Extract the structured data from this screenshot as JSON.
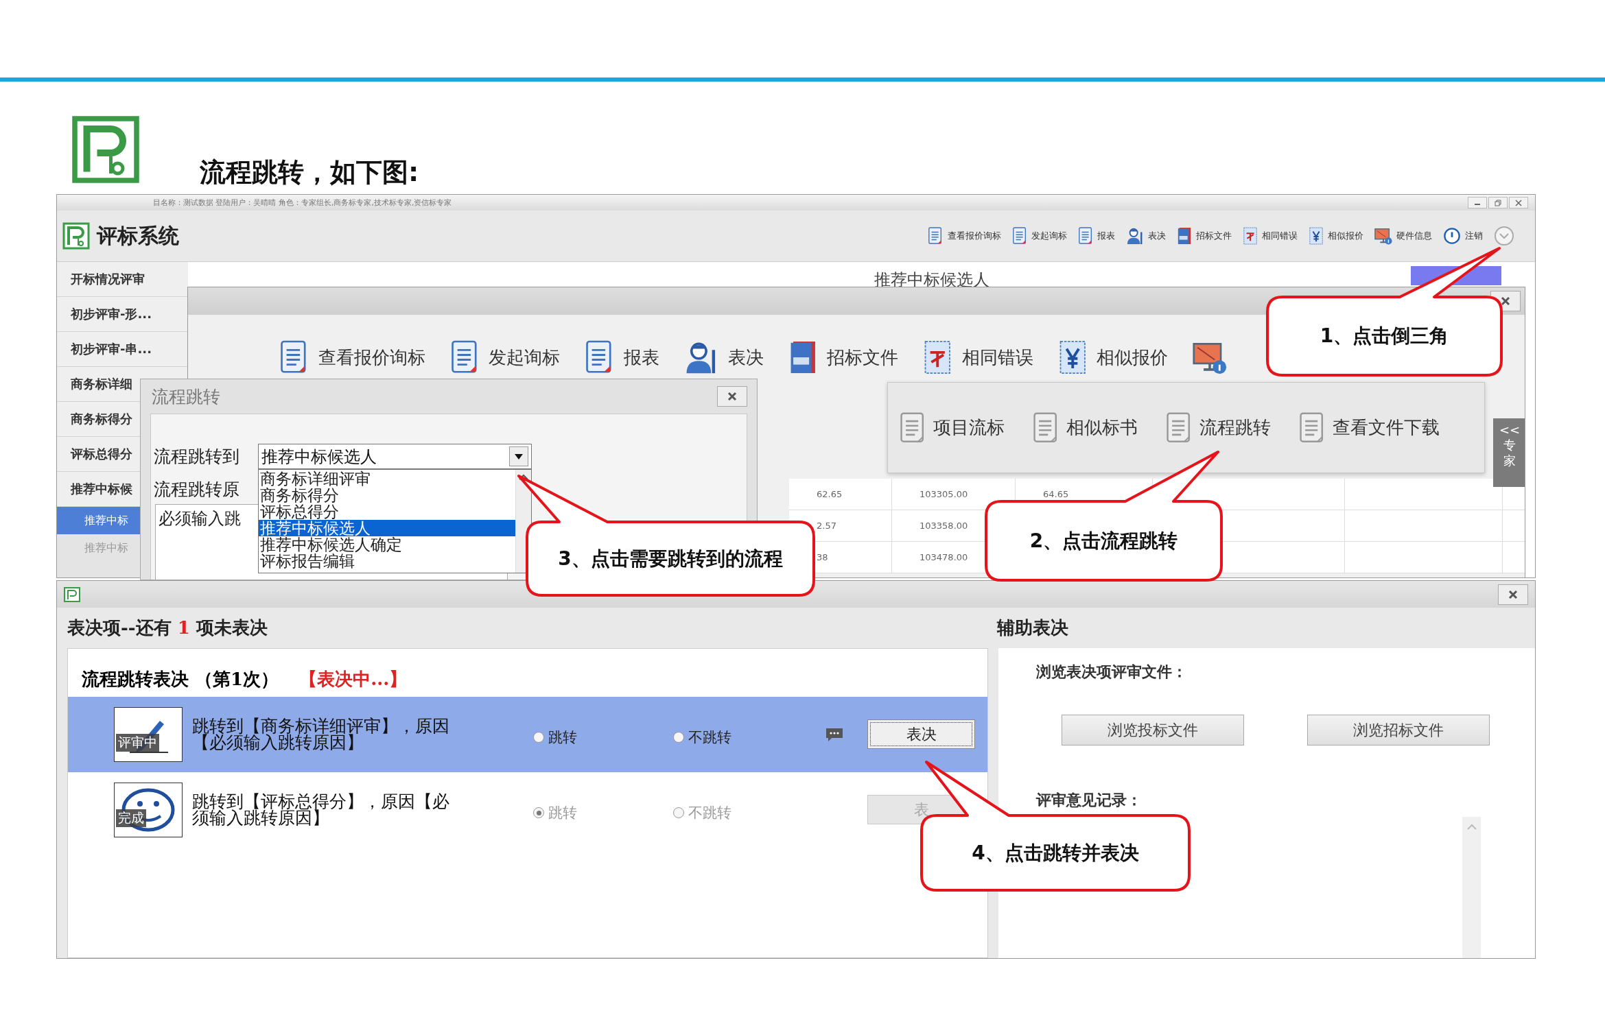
{
  "slide": {
    "title": "流程跳转，如下图:"
  },
  "main_window": {
    "info_bar": "目名称：测试数据 登陆用户：吴晴晴 角色：专家组长,商务标专家,技术标专家,资信标专家",
    "app_title": "评标系统",
    "toolbar": [
      {
        "label": "查看报价询标"
      },
      {
        "label": "发起询标"
      },
      {
        "label": "报表"
      },
      {
        "label": "表决"
      },
      {
        "label": "招标文件"
      },
      {
        "label": "相同错误"
      },
      {
        "label": "相似报价"
      },
      {
        "label": "硬件信息"
      },
      {
        "label": "注销"
      }
    ],
    "sidebar": {
      "items": [
        {
          "label": "开标情况评审",
          "selected": false
        },
        {
          "label": "初步评审-形...",
          "selected": false
        },
        {
          "label": "初步评审-串...",
          "selected": false
        },
        {
          "label": "商务标详细",
          "selected": false
        },
        {
          "label": "商务标得分",
          "selected": false
        },
        {
          "label": "评标总得分",
          "selected": false
        },
        {
          "label": "推荐中标候",
          "selected": false,
          "children": [
            {
              "label": "推荐中标",
              "selected": true
            },
            {
              "label": "推荐中标",
              "selected": false
            }
          ]
        }
      ]
    },
    "content_title": "推荐中标候选人"
  },
  "tool_window": {
    "toolbar": [
      {
        "label": "查看报价询标"
      },
      {
        "label": "发起询标"
      },
      {
        "label": "报表"
      },
      {
        "label": "表决"
      },
      {
        "label": "招标文件"
      },
      {
        "label": "相同错误"
      },
      {
        "label": "相似报价"
      }
    ],
    "menu": {
      "items": [
        {
          "label": "项目流标"
        },
        {
          "label": "相似标书"
        },
        {
          "label": "流程跳转"
        },
        {
          "label": "查看文件下载"
        }
      ]
    },
    "table": {
      "rows": [
        [
          "62.65",
          "103305.00",
          "64.65"
        ],
        [
          "2.57",
          "103358.00"
        ],
        [
          "38",
          "103478.00"
        ]
      ]
    },
    "side_tab": {
      "arrows": "<<",
      "label": "专家"
    }
  },
  "jump_dialog": {
    "title": "流程跳转",
    "target_label": "流程跳转到",
    "target_value": "推荐中标候选人",
    "reason_label": "流程跳转原",
    "reason_value": "必须输入跳",
    "options": [
      {
        "label": "商务标详细评审",
        "selected": false
      },
      {
        "label": "商务标得分",
        "selected": false
      },
      {
        "label": "评标总得分",
        "selected": false
      },
      {
        "label": "推荐中标候选人",
        "selected": true
      },
      {
        "label": "推荐中标候选人确定",
        "selected": false
      },
      {
        "label": "评标报告编辑",
        "selected": false
      }
    ]
  },
  "vote_window": {
    "pending": {
      "prefix": "表决项--还有",
      "count": "1",
      "suffix": "项未表决"
    },
    "section": {
      "title": "流程跳转表决 （第1次）",
      "status": "【表决中...】"
    },
    "items": [
      {
        "status": {
          "kind": "in_review",
          "label": "评审中"
        },
        "text": "跳转到【商务标详细评审】，原因【必须输入跳转原因】",
        "selected": true,
        "options": [
          {
            "label": "跳转",
            "checked": false,
            "disabled": false
          },
          {
            "label": "不跳转",
            "checked": false,
            "disabled": false
          }
        ],
        "comment": true,
        "button": {
          "label": "表决",
          "disabled": false
        }
      },
      {
        "status": {
          "kind": "done",
          "label": "完成"
        },
        "text": "跳转到【评标总得分】，原因【必须输入跳转原因】",
        "selected": false,
        "options": [
          {
            "label": "跳转",
            "checked": true,
            "disabled": true
          },
          {
            "label": "不跳转",
            "checked": false,
            "disabled": true
          }
        ],
        "comment": false,
        "button": {
          "label": "表",
          "disabled": true
        }
      }
    ],
    "assist": {
      "title": "辅助表决",
      "files_label": "浏览表决项评审文件：",
      "buttons": [
        "浏览投标文件",
        "浏览招标文件"
      ],
      "notes_label": "评审意见记录："
    }
  },
  "callouts": [
    {
      "text": "1、点击倒三角"
    },
    {
      "text": "2、点击流程跳转"
    },
    {
      "text": "3、点击需要跳转到的流程"
    },
    {
      "text": "4、点击跳转并表决"
    }
  ]
}
